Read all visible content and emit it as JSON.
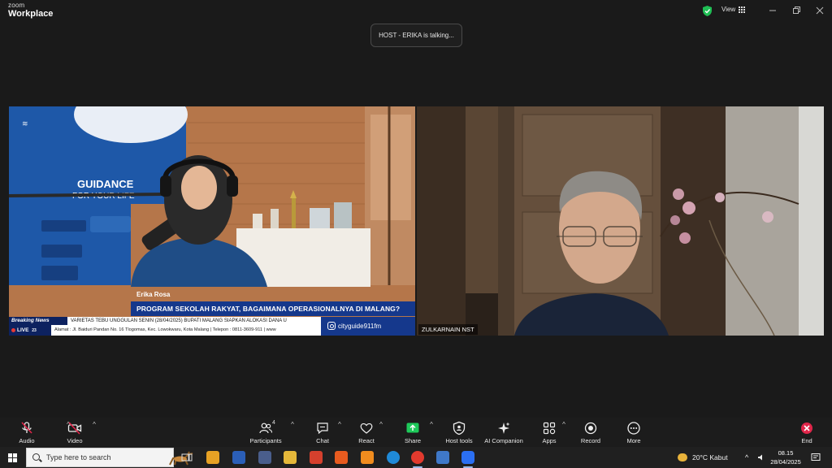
{
  "window": {
    "brand_top": "zoom",
    "brand_bottom": "Workplace",
    "view_label": "View"
  },
  "talking_banner": "HOST - ERIKA is talking...",
  "left_tile": {
    "person_name": "Erika Rosa",
    "headline": "PROGRAM SEKOLAH RAKYAT, BAGAIMANA OPERASIONALNYA DI MALANG?",
    "ticker_label": "Breaking News",
    "ticker_text": "VARIETAS TEBU UNGGULAN    SENIN (28/04/2025) BUPATI MALANG SIAPKAN ALOKASI DANA U",
    "live_label": "LIVE",
    "live_num": "23",
    "address": "Alamat : Jl. Baiduri Pandan No. 16 Tlogomas, Kec. Lowokwaru, Kota Malang | Telepon : 0811-3609-911 | www",
    "instagram": "cityguide911fm",
    "backdrop_text": "GUIDANCE",
    "backdrop_sub": "FOR YOUR LIFE"
  },
  "right_tile": {
    "participant_name": "ZULKARNAIN NST"
  },
  "toolbar": {
    "audio": "Audio",
    "video": "Video",
    "participants": "Participants",
    "participants_count": "4",
    "chat": "Chat",
    "react": "React",
    "share": "Share",
    "host_tools": "Host tools",
    "ai_companion": "AI Companion",
    "apps": "Apps",
    "record": "Record",
    "more": "More",
    "end": "End"
  },
  "taskbar": {
    "search_placeholder": "Type here to search",
    "weather": "20°C  Kabut",
    "time": "08.15",
    "date": "28/04/2025"
  },
  "colors": {
    "share_green": "#1ec95a",
    "end_red": "#e0264a",
    "headline_blue": "#15388c"
  }
}
